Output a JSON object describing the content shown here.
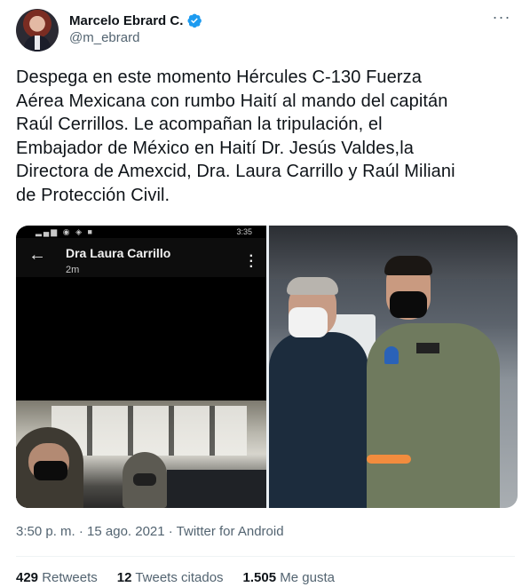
{
  "author": {
    "name": "Marcelo Ebrard C.",
    "handle": "@m_ebrard",
    "verified_color": "#1d9bf0"
  },
  "more_icon": "ellipsis-icon",
  "tweet": {
    "text": "Despega en este momento Hércules C-130 Fuerza\nAérea Mexicana con rumbo Haití al mando del capitán\nRaúl Cerrillos. Le acompañan la tripulación, el\nEmbajador de México en Haití Dr. Jesús Valdes,la\nDirectora de Amexcid, Dra. Laura Carrillo y Raúl Miliani\nde Protección Civil."
  },
  "media": {
    "left_screenshot": {
      "status_time": "3:35",
      "chat_title": "Dra Laura Carrillo",
      "chat_subtitle": "2m"
    }
  },
  "meta": {
    "timestamp": "3:50 p. m. · 15 ago. 2021 · Twitter for Android"
  },
  "stats": {
    "retweets_count": "429",
    "retweets_label": "Retweets",
    "quotes_count": "12",
    "quotes_label": "Tweets citados",
    "likes_count": "1.505",
    "likes_label": "Me gusta"
  }
}
